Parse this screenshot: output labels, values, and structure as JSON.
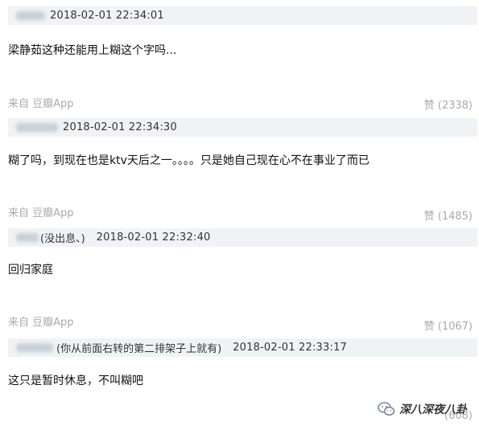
{
  "comments": [
    {
      "nick_note": "",
      "time": "2018-02-01 22:34:01",
      "text": "梁静茹这种还能用上糊这个字吗...",
      "source": "来自 豆瓣App",
      "likes": "赞 (2338)"
    },
    {
      "nick_note": "",
      "time": "2018-02-01 22:34:30",
      "text": "糊了吗，到现在也是ktv天后之一。。。。只是她自己现在心不在事业了而已",
      "source": "来自 豆瓣App",
      "likes": "赞 (1485)"
    },
    {
      "nick_note": "(没出息、)",
      "time": "2018-02-01 22:32:40",
      "text": "回归家庭",
      "source": "来自 豆瓣App",
      "likes": "赞 (1067)"
    },
    {
      "nick_note": "(你从前面右转的第二排架子上就有)",
      "time": "2018-02-01 22:33:17",
      "text": "这只是暂时休息，不叫糊吧",
      "source": "",
      "likes": "(608)"
    }
  ],
  "watermark": {
    "text": "深八深夜八卦",
    "icon": "wechat-icon"
  }
}
